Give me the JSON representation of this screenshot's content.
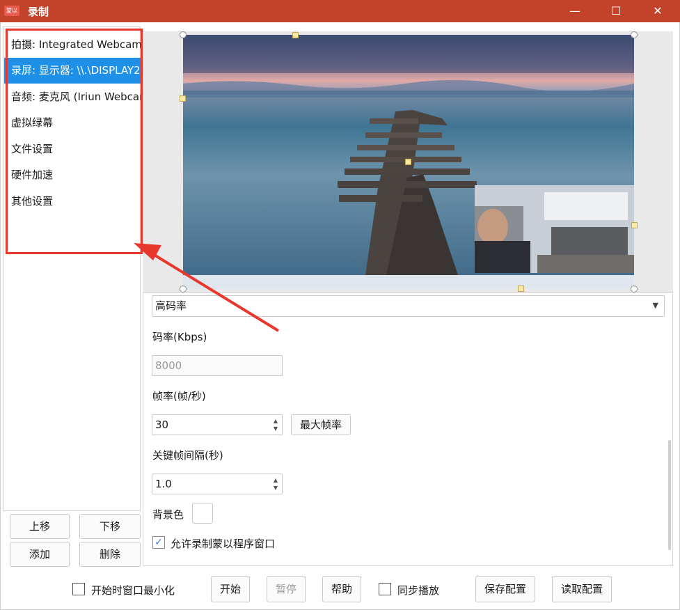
{
  "window": {
    "icon_text": "蒙以",
    "title": "录制",
    "min_glyph": "—",
    "max_glyph": "☐",
    "close_glyph": "✕"
  },
  "sidebar": {
    "items": [
      {
        "label": "拍摄: Integrated Webcam"
      },
      {
        "label": "录屏: 显示器: \\\\.\\DISPLAY2"
      },
      {
        "label": "音频: 麦克风 (Iriun Webcam)"
      },
      {
        "label": "虚拟绿幕"
      },
      {
        "label": "文件设置"
      },
      {
        "label": "硬件加速"
      },
      {
        "label": "其他设置"
      }
    ],
    "selected_index": 1
  },
  "source_buttons": {
    "move_up": "上移",
    "move_down": "下移",
    "add": "添加",
    "delete": "删除"
  },
  "settings": {
    "quality_select": "高码率",
    "bitrate_label": "码率(Kbps)",
    "bitrate_value": "8000",
    "framerate_label": "帧率(帧/秒)",
    "framerate_value": "30",
    "max_framerate_button": "最大帧率",
    "keyframe_label": "关键帧间隔(秒)",
    "keyframe_value": "1.0",
    "bgcolor_label": "背景色",
    "allow_record_label": "允许录制蒙以程序窗口",
    "allow_record_checked": true
  },
  "bottom_bar": {
    "minimize_on_start_label": "开始时窗口最小化",
    "minimize_on_start_checked": false,
    "start": "开始",
    "pause": "暂停",
    "help": "帮助",
    "sync_play_label": "同步播放",
    "sync_play_checked": false,
    "save_config": "保存配置",
    "load_config": "读取配置"
  },
  "colors": {
    "titlebar": "#c2432a",
    "selection": "#1e90e8",
    "annotation": "#e8382d"
  }
}
